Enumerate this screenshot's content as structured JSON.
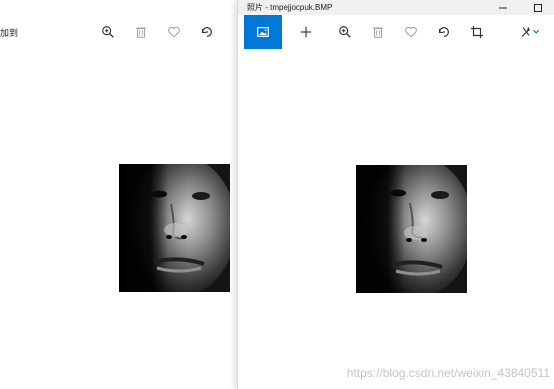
{
  "left_window": {
    "label": "加到",
    "toolbar": [
      {
        "icon": "zoom-in-icon"
      },
      {
        "icon": "delete-icon"
      },
      {
        "icon": "favorite-icon"
      },
      {
        "icon": "rotate-icon"
      }
    ],
    "photo": {
      "icon": "face-photo"
    }
  },
  "right_window": {
    "title": "照片 - tmpejjocpuk.BMP",
    "controls": [
      "minimize-icon",
      "maximize-icon"
    ],
    "toolbar": [
      {
        "icon": "view-collection-icon",
        "active": true
      },
      {
        "icon": "add-icon"
      },
      {
        "icon": "zoom-in-icon"
      },
      {
        "icon": "delete-icon"
      },
      {
        "icon": "favorite-icon"
      },
      {
        "icon": "rotate-icon"
      },
      {
        "icon": "crop-icon"
      },
      {
        "icon": "edit-icon"
      }
    ],
    "photo": {
      "icon": "face-photo"
    }
  },
  "colors": {
    "accent": "#0078d7",
    "titlebar": "#f0f0f0",
    "icon": "#333333",
    "icon_muted": "#a0a0a0"
  },
  "watermark": "https://blog.csdn.net/weixin_43840511"
}
